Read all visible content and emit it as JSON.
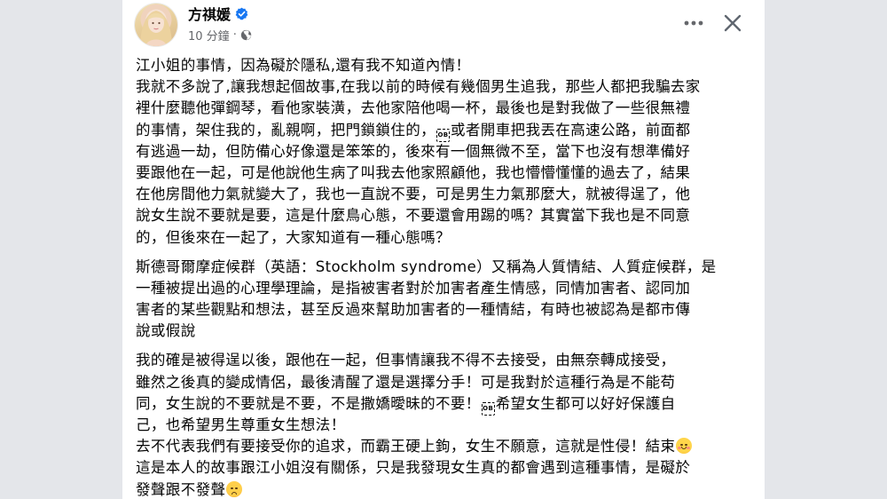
{
  "post": {
    "author_name": "方祺媛",
    "time": "10 分鐘",
    "separator": "·",
    "icons": {
      "verified": "verified-badge-icon",
      "audience": "globe-icon",
      "more": "more-options-icon",
      "close": "close-icon"
    },
    "colors": {
      "verified": "#1877f2",
      "meta": "#65676b",
      "text": "#050505"
    },
    "paragraphs": [
      {
        "lines": [
          [
            "江小姐的事情，因為礙於隱私,還有我不知道內情！"
          ],
          [
            "我就不多說了,讓我想起個故事,在我以前的時候有幾個男生追我，那些人都把我騙去家"
          ],
          [
            "裡什麼聽他彈鋼琴，看他家裝潢，去他家陪他喝一杯，最後也是對我做了一些很無禮"
          ],
          [
            "的事情，架住我的，亂親啊，把門鎖鎖住的，",
            "OB",
            "或者開車把我丟在高速公路，前面都"
          ],
          [
            "有逃過一劫，但防備心好像還是笨笨的，後來有一個無微不至，當下也沒有想準備好"
          ],
          [
            "要跟他在一起，可是他說他生病了叫我去他家照顧他，我也懵懵懂懂的過去了，結果"
          ],
          [
            "在他房間他力氣就變大了，我也一直說不要，可是男生力氣那麼大，就被得逞了，他"
          ],
          [
            "說女生說不要就是要，這是什麼鳥心態，不要還會用踢的嗎？其實當下我也是不同意"
          ],
          [
            "的，但後來在一起了，大家知道有一種心態嗎？"
          ]
        ]
      },
      {
        "lines": [
          [
            "斯德哥爾摩症候群（英語：Stockholm syndrome）又稱為人質情結、人質症候群，是"
          ],
          [
            "一種被提出過的心理學理論，是指被害者對於加害者產生情感，同情加害者、認同加"
          ],
          [
            "害者的某些觀點和想法，甚至反過來幫助加害者的一種情結，有時也被認為是都市傳"
          ],
          [
            "說或假說"
          ]
        ]
      },
      {
        "lines": [
          [
            "我的確是被得逞以後，跟他在一起，但事情讓我不得不去接受，由無奈轉成接受，"
          ],
          [
            "雖然之後真的變成情侶，最後清醒了還是選擇分手！可是我對於這種行為是不能苟"
          ],
          [
            "同，女生說的不要就是不要，不是撒嬌曖昧的不要！",
            "OB",
            "希望女生都可以好好保護自"
          ],
          [
            "己，也希望男生尊重女生想法！"
          ],
          [
            "去不代表我們有要接受你的追求，而霸王硬上鉤，女生不願意，這就是性侵！結束",
            "smiling-face-with-blush"
          ],
          [
            "這是本人的故事跟江小姐沒有關係，只是我發現女生真的都會遇到這種事情，是礙於"
          ],
          [
            "發聲跟不發聲",
            "worried-face"
          ]
        ]
      }
    ]
  }
}
